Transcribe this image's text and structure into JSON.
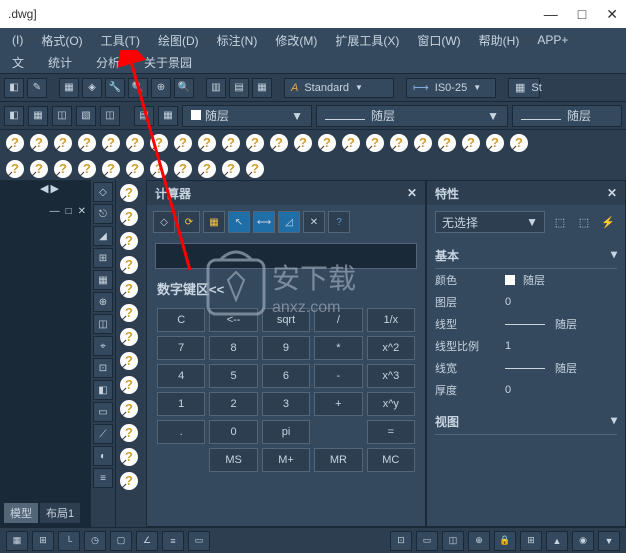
{
  "title": ".dwg]",
  "menu": [
    "格式(O)",
    "工具(T)",
    "绘图(D)",
    "标注(N)",
    "修改(M)",
    "扩展工具(X)",
    "窗口(W)",
    "帮助(H)",
    "APP+"
  ],
  "submenu": [
    "统计",
    "分析",
    "关于景园"
  ],
  "leftmenu1": "(I)",
  "leftmenu2": "文",
  "style_label": "Standard",
  "iso_label": "IS0-25",
  "st_label": "St",
  "layer_text": "随层",
  "calculator": {
    "title": "计算器",
    "keypad_label": "数字键区<<",
    "keys": [
      "C",
      "<--",
      "sqrt",
      "/",
      "1/x",
      "7",
      "8",
      "9",
      "*",
      "x^2",
      "4",
      "5",
      "6",
      "-",
      "x^3",
      "1",
      "2",
      "3",
      "+",
      "x^y",
      ".",
      "0",
      "pi",
      "",
      "=",
      "",
      "MS",
      "M+",
      "MR",
      "MC"
    ]
  },
  "properties": {
    "title": "特性",
    "noselect": "无选择",
    "section_basic": "基本",
    "section_view": "视图",
    "rows": [
      {
        "k": "颜色",
        "v": "随层",
        "sq": true
      },
      {
        "k": "图层",
        "v": "0"
      },
      {
        "k": "线型",
        "v": "随层",
        "line": true
      },
      {
        "k": "线型比例",
        "v": "1"
      },
      {
        "k": "线宽",
        "v": "随层",
        "line": true
      },
      {
        "k": "厚度",
        "v": "0"
      }
    ]
  },
  "lefttabs": {
    "model": "模型",
    "layout": "布局1"
  },
  "watermark_text": "安下载",
  "watermark_url": "anxz.com"
}
